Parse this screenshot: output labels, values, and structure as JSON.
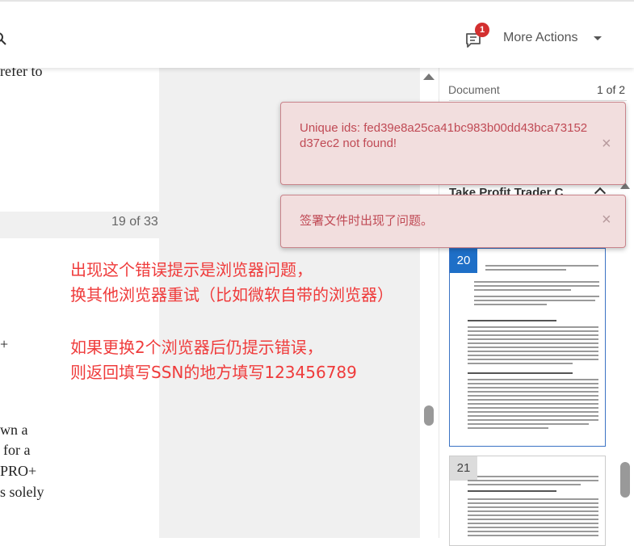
{
  "header": {
    "notification_count": "1",
    "more_actions_label": "More Actions"
  },
  "document_text": {
    "line_1": "refer to",
    "line_2": "+",
    "line_3": "wn a",
    "line_4": "for a",
    "line_5": "PRO+",
    "line_6": "s solely"
  },
  "page_counter": "19 of 33",
  "sidebar": {
    "document_label": "Document",
    "document_count": "1 of 2",
    "document_title": "Take Profit Trader C",
    "thumbnails": [
      {
        "page": "20"
      },
      {
        "page": "21"
      }
    ]
  },
  "toasts": [
    {
      "message": "Unique ids: fed39e8a25ca41bc983b00dd43bca73152d37ec2 not found!",
      "close": "×"
    },
    {
      "message": "签署文件时出现了问题。",
      "close": "×"
    }
  ],
  "annotation": {
    "line_1": "出现这个错误提示是浏览器问题，",
    "line_2": "换其他浏览器重试（比如微软自带的浏览器）",
    "line_3": "如果更换2个浏览器后仍提示错误，",
    "line_4": "则返回填写SSN的地方填写123456789"
  },
  "colors": {
    "toast_bg": "#f2dede",
    "toast_text": "#c04a55",
    "annotation": "#ef3b3b",
    "badge": "#d32f2f",
    "thumb_active": "#1e6fc7"
  },
  "icons": [
    "search-icon",
    "chat-icon",
    "chevron-down-icon",
    "chevron-up-icon",
    "close-icon"
  ]
}
